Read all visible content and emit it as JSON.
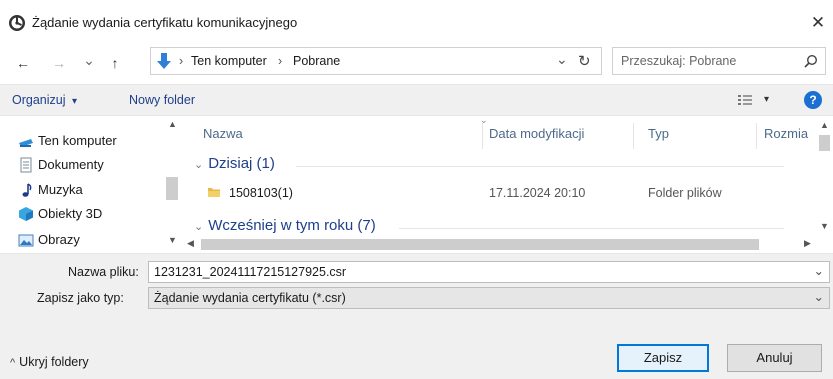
{
  "window": {
    "title": "Żądanie wydania certyfikatu komunikacyjnego",
    "close_label": "✕"
  },
  "nav": {
    "back": "←",
    "forward": "→",
    "recent": "⌄",
    "up": "↑",
    "path": [
      "Ten komputer",
      "Pobrane"
    ],
    "separator": "›",
    "refresh": "↻",
    "dropdown": "⌄",
    "search_placeholder": "Przeszukaj: Pobrane"
  },
  "toolbar": {
    "organize_label": "Organizuj",
    "organize_arrow": "▾",
    "new_folder_label": "Nowy folder",
    "view_arrow": "▾",
    "help_label": "?"
  },
  "sidebar": {
    "items": [
      {
        "label": "Ten komputer",
        "icon": "computer-icon"
      },
      {
        "label": "Dokumenty",
        "icon": "documents-icon"
      },
      {
        "label": "Muzyka",
        "icon": "music-icon"
      },
      {
        "label": "Obiekty 3D",
        "icon": "3d-objects-icon"
      },
      {
        "label": "Obrazy",
        "icon": "pictures-icon"
      }
    ]
  },
  "filelist": {
    "columns": [
      "Nazwa",
      "Data modyfikacji",
      "Typ",
      "Rozmia"
    ],
    "groups": [
      {
        "label": "Dzisiaj (1)",
        "rows": [
          {
            "name": "1508103(1)",
            "date": "17.11.2024 20:10",
            "type": "Folder plików"
          }
        ]
      },
      {
        "label": "Wcześniej w tym roku (7)",
        "rows": []
      }
    ]
  },
  "save": {
    "filename_label": "Nazwa pliku:",
    "filename_value": "1231231_20241117215127925.csr",
    "filetype_label": "Zapisz jako typ:",
    "filetype_value": "Żądanie wydania certyfikatu (*.csr)",
    "hide_folders_label": "Ukryj foldery",
    "hide_folders_arrow": "^",
    "save_button": "Zapisz",
    "cancel_button": "Anuluj"
  },
  "colors": {
    "accent": "#0078d7",
    "folder": "#e8b94a",
    "group_text": "#1e3f8a"
  }
}
